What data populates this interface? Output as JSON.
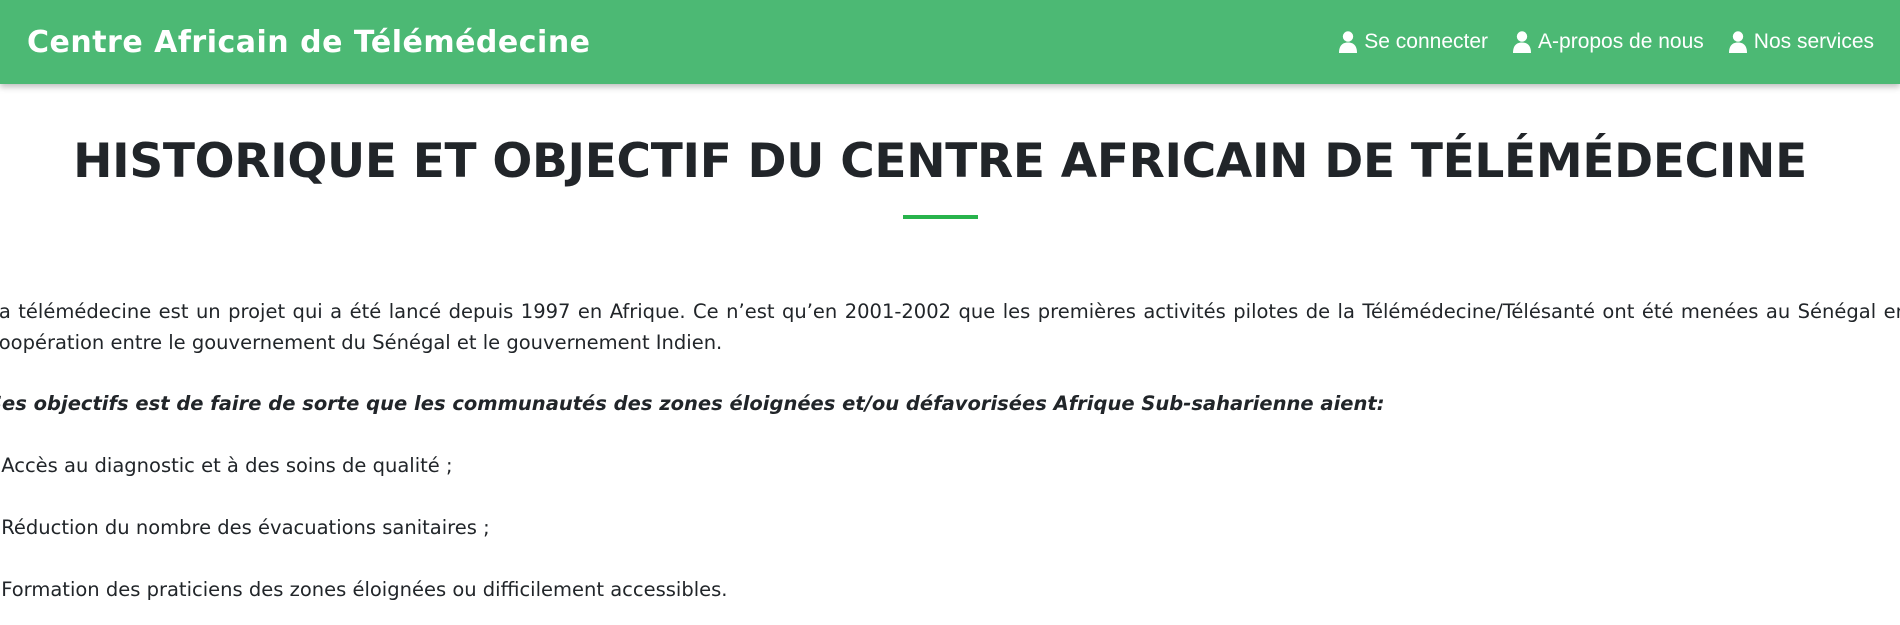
{
  "header": {
    "brand": "Centre Africain de Télémédecine",
    "nav": [
      {
        "label": "Se connecter",
        "icon": "user-icon"
      },
      {
        "label": "A-propos de nous",
        "icon": "user-icon"
      },
      {
        "label": "Nos services",
        "icon": "user-icon"
      }
    ]
  },
  "main": {
    "title": "HISTORIQUE ET OBJECTIF DU CENTRE AFRICAIN DE TÉLÉMÉDECINE",
    "intro": "La télémédecine est un projet qui a été lancé depuis 1997 en Afrique. Ce n’est qu’en 2001-2002 que les premières activités pilotes de la Télémédecine/Télésanté ont été menées au Sénégal en coopération entre le gouvernement du Sénégal et le gouvernement Indien.",
    "objectives_heading": "Ses objectifs est de faire de sorte que les communautés des zones éloignées et/ou défavorisées Afrique Sub-saharienne aient:",
    "objectives": [
      "- Accès au diagnostic et à des soins de qualité ;",
      "- Réduction du nombre des évacuations sanitaires ;",
      "- Formation des praticiens des zones éloignées ou difficilement accessibles."
    ]
  },
  "colors": {
    "navbar": "#4cb974",
    "divider": "#28b34c",
    "text": "#212529"
  }
}
